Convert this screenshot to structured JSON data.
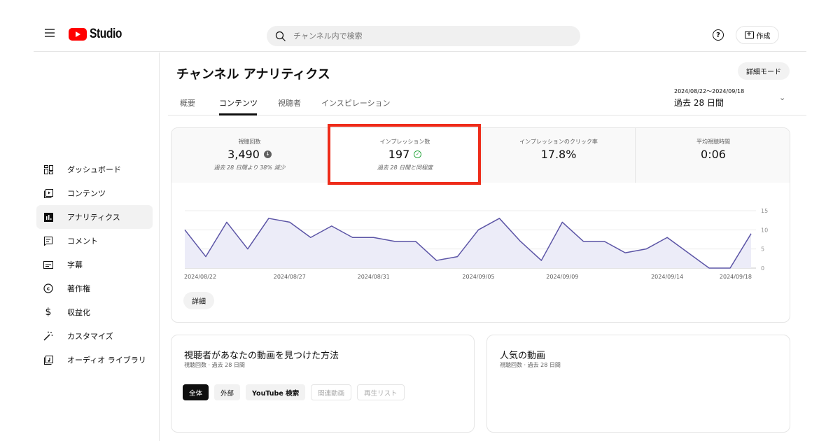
{
  "app": {
    "logo_text": "Studio",
    "search_placeholder": "チャンネル内で検索",
    "help_label": "?",
    "create_label": "作成"
  },
  "sidebar": {
    "items": [
      {
        "label": "ダッシュボード",
        "icon": "dashboard-icon",
        "active": false
      },
      {
        "label": "コンテンツ",
        "icon": "content-icon",
        "active": false
      },
      {
        "label": "アナリティクス",
        "icon": "analytics-icon",
        "active": true
      },
      {
        "label": "コメント",
        "icon": "comment-icon",
        "active": false
      },
      {
        "label": "字幕",
        "icon": "subtitles-icon",
        "active": false
      },
      {
        "label": "著作権",
        "icon": "copyright-icon",
        "active": false
      },
      {
        "label": "収益化",
        "icon": "dollar-icon",
        "active": false
      },
      {
        "label": "カスタマイズ",
        "icon": "magic-wand-icon",
        "active": false
      },
      {
        "label": "オーディオ ライブラリ",
        "icon": "audio-library-icon",
        "active": false
      }
    ]
  },
  "page": {
    "title": "チャンネル アナリティクス",
    "detail_mode_label": "詳細モード",
    "tabs": [
      {
        "label": "概要",
        "active": false
      },
      {
        "label": "コンテンツ",
        "active": true
      },
      {
        "label": "視聴者",
        "active": false
      },
      {
        "label": "インスピレーション",
        "active": false
      }
    ],
    "date_range": {
      "range": "2024/08/22～2024/09/18",
      "label": "過去 28 日間"
    }
  },
  "metrics": [
    {
      "label": "視聴回数",
      "value": "3,490",
      "comparison": "過去 28 日間より 38% 減少",
      "status": "down"
    },
    {
      "label": "インプレッション数",
      "value": "197",
      "comparison": "過去 28 日間と同程度",
      "status": "ok"
    },
    {
      "label": "インプレッションのクリック率",
      "value": "17.8%",
      "comparison": "",
      "status": ""
    },
    {
      "label": "平均視聴時間",
      "value": "0:06",
      "comparison": "",
      "status": ""
    }
  ],
  "colors": {
    "line": "#5c55a6",
    "fill": "#ececf8",
    "highlight": "#ee2c1a",
    "ok": "#2ba640"
  },
  "chart_data": {
    "type": "area",
    "title": "インプレッション数",
    "x": [
      "2024/08/22",
      "2024/08/23",
      "2024/08/24",
      "2024/08/25",
      "2024/08/26",
      "2024/08/27",
      "2024/08/28",
      "2024/08/29",
      "2024/08/30",
      "2024/08/31",
      "2024/09/01",
      "2024/09/02",
      "2024/09/03",
      "2024/09/04",
      "2024/09/05",
      "2024/09/06",
      "2024/09/07",
      "2024/09/08",
      "2024/09/09",
      "2024/09/10",
      "2024/09/11",
      "2024/09/12",
      "2024/09/13",
      "2024/09/14",
      "2024/09/15",
      "2024/09/16",
      "2024/09/17",
      "2024/09/18"
    ],
    "values": [
      10,
      3,
      12,
      5,
      13,
      12,
      8,
      11,
      8,
      8,
      7,
      7,
      2,
      3,
      10,
      13,
      7,
      2,
      12,
      7,
      7,
      4,
      5,
      8,
      4,
      0,
      0,
      9
    ],
    "x_tick_labels": [
      {
        "index": 0,
        "label": "2024/08/22"
      },
      {
        "index": 5,
        "label": "2024/08/27"
      },
      {
        "index": 9,
        "label": "2024/08/31"
      },
      {
        "index": 14,
        "label": "2024/09/05"
      },
      {
        "index": 18,
        "label": "2024/09/09"
      },
      {
        "index": 23,
        "label": "2024/09/14"
      },
      {
        "index": 27,
        "label": "2024/09/18"
      }
    ],
    "y_ticks": [
      0,
      5,
      10,
      15
    ],
    "ylim": [
      0,
      15
    ],
    "grid": true,
    "y_axis_side": "right"
  },
  "detail_button_label": "詳細",
  "traffic_card": {
    "title": "視聴者があなたの動画を見つけた方法",
    "subtitle": "視聴回数 · 過去 28 日間",
    "chips": [
      {
        "label": "全体",
        "state": "active"
      },
      {
        "label": "外部",
        "state": "normal"
      },
      {
        "label": "YouTube 検索",
        "state": "bold"
      },
      {
        "label": "関連動画",
        "state": "disabled"
      },
      {
        "label": "再生リスト",
        "state": "disabled"
      }
    ]
  },
  "popular_card": {
    "title": "人気の動画",
    "subtitle": "視聴回数 · 過去 28 日間"
  }
}
